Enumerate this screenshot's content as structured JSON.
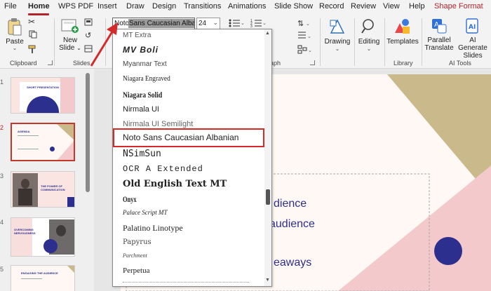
{
  "tabs": [
    {
      "label": "File"
    },
    {
      "label": "Home"
    },
    {
      "label": "WPS PDF"
    },
    {
      "label": "Insert"
    },
    {
      "label": "Draw"
    },
    {
      "label": "Design"
    },
    {
      "label": "Transitions"
    },
    {
      "label": "Animations"
    },
    {
      "label": "Slide Show"
    },
    {
      "label": "Record"
    },
    {
      "label": "Review"
    },
    {
      "label": "View"
    },
    {
      "label": "Help"
    },
    {
      "label": "Shape Format"
    }
  ],
  "ribbon": {
    "paste_label": "Paste",
    "clipboard_label": "Clipboard",
    "new_slide_label": "New",
    "new_slide_label2": "Slide",
    "slides_label": "Slides",
    "font_box_prefix": "Noto",
    "font_box_selected": "Sans Caucasian Albani",
    "font_size": "24",
    "paragraph_label_tail": "aph",
    "drawing_label": "Drawing",
    "editing_label": "Editing",
    "templates_label": "Templates",
    "library_label": "Library",
    "parallel_label": "Parallel",
    "translate_label": "Translate",
    "ai_generate_label": "AI Generate",
    "slides_label2": "Slides",
    "ai_tools_label": "AI Tools"
  },
  "colors": {
    "accent": "#b5232a",
    "highlight_border": "#d42a2a",
    "slide_navy": "#2d2f8f",
    "slide_tan": "#c9b98b",
    "slide_pink": "#f4c9cc"
  },
  "font_list": [
    {
      "name": "MT Extra"
    },
    {
      "name": "MV Boli"
    },
    {
      "name": "Myanmar Text"
    },
    {
      "name": "Niagara Engraved"
    },
    {
      "name": "Niagara Solid"
    },
    {
      "name": "Nirmala UI"
    },
    {
      "name": "Nirmala UI Semilight"
    },
    {
      "name": "Noto Sans Caucasian Albanian"
    },
    {
      "name": "NSimSun"
    },
    {
      "name": "OCR A Extended"
    },
    {
      "name": "Old English Text MT"
    },
    {
      "name": "Onyx"
    },
    {
      "name": "Palace Script MT"
    },
    {
      "name": "Palatino Linotype"
    },
    {
      "name": "Papyrus"
    },
    {
      "name": "Parchment"
    },
    {
      "name": "Perpetua"
    }
  ],
  "slide_text": [
    {
      "text": "dience"
    },
    {
      "text": "audience"
    },
    {
      "text": "eaways"
    }
  ],
  "slide_numbers": [
    {
      "n": "1"
    },
    {
      "n": "2"
    },
    {
      "n": "3"
    },
    {
      "n": "4"
    },
    {
      "n": "5"
    }
  ],
  "thumb_text": {
    "t1": "SHORT PRESENTATION",
    "t2": "AGENDA",
    "t3": "THE POWER OF COMMUNICATION",
    "t4": "OVERCOMING NERVOUSNESS",
    "t5": "ENGAGING THE AUDIENCE"
  }
}
